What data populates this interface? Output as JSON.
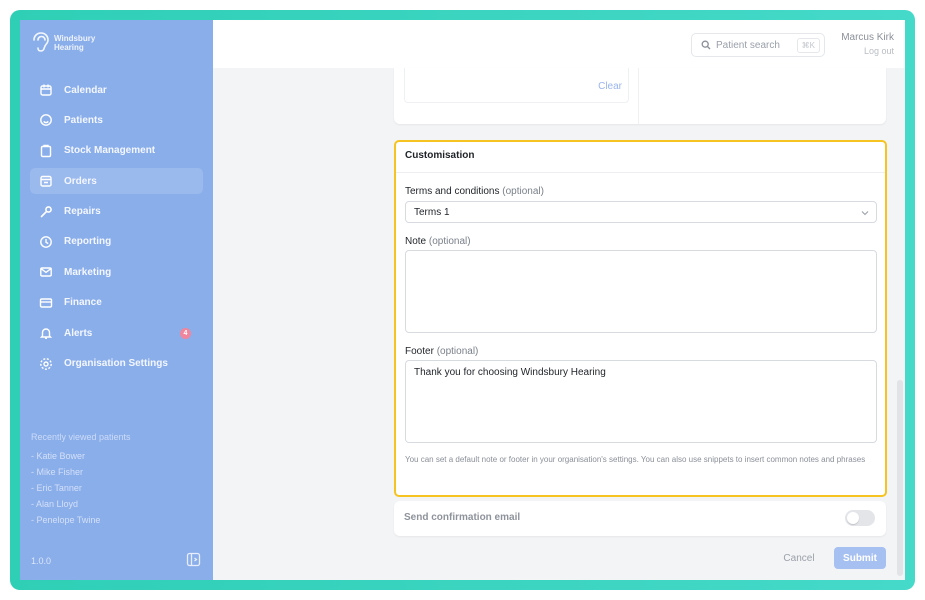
{
  "brand": {
    "line1": "Windsbury",
    "line2": "Hearing"
  },
  "sidebar": {
    "items": [
      {
        "label": "Calendar",
        "icon": "calendar-icon"
      },
      {
        "label": "Patients",
        "icon": "smile-icon"
      },
      {
        "label": "Stock Management",
        "icon": "clipboard-icon"
      },
      {
        "label": "Orders",
        "icon": "orders-icon",
        "active": true
      },
      {
        "label": "Repairs",
        "icon": "wrench-icon"
      },
      {
        "label": "Reporting",
        "icon": "clock-icon"
      },
      {
        "label": "Marketing",
        "icon": "mail-icon"
      },
      {
        "label": "Finance",
        "icon": "card-icon"
      },
      {
        "label": "Alerts",
        "icon": "bell-icon",
        "badge": "4"
      },
      {
        "label": "Organisation Settings",
        "icon": "settings-icon"
      }
    ],
    "recent_title": "Recently viewed patients",
    "recent": [
      "- Katie Bower",
      "- Mike Fisher",
      "- Eric Tanner",
      "- Alan Lloyd",
      "- Penelope Twine"
    ],
    "version": "1.0.0"
  },
  "header": {
    "search_label": "Patient search",
    "search_shortcut": "⌘K",
    "user_name": "Marcus Kirk",
    "logout": "Log out"
  },
  "top_card": {
    "clear_label": "Clear"
  },
  "customisation": {
    "title": "Customisation",
    "terms_label": "Terms and conditions",
    "terms_optional": "(optional)",
    "terms_value": "Terms 1",
    "note_label": "Note",
    "note_optional": "(optional)",
    "note_value": "",
    "footer_label": "Footer",
    "footer_optional": "(optional)",
    "footer_value": "Thank you for choosing Windsbury Hearing",
    "help": "You can set a default note or footer in your organisation's settings. You can also use snippets to insert common notes and phrases"
  },
  "confirmation": {
    "label": "Send confirmation email",
    "enabled": false
  },
  "actions": {
    "cancel": "Cancel",
    "submit": "Submit"
  },
  "colors": {
    "sidebar": "#8aaeea",
    "highlight": "#f6c421",
    "frame": "#3dd5bf",
    "submit": "#a7c0f2"
  }
}
